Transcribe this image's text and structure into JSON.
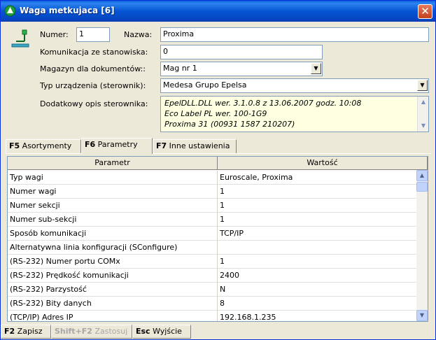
{
  "window": {
    "title": "Waga metkujaca [6]",
    "close_glyph": "✕"
  },
  "form": {
    "numer_label": "Numer:",
    "numer_value": "1",
    "nazwa_label": "Nazwa:",
    "nazwa_value": "Proxima",
    "komunikacja_label": "Komunikacja ze stanowiska:",
    "komunikacja_value": "0",
    "magazyn_label": "Magazyn dla dokumentów::",
    "magazyn_value": "Mag nr 1",
    "typ_label": "Typ urządzenia (sterownik):",
    "typ_value": "Medesa Grupo Epelsa",
    "opis_label": "Dodatkowy opis sterownika:",
    "opis_lines": [
      "EpelDLL.DLL wer. 3.1.0.8 z 13.06.2007 godz. 10:08",
      "Eco Label PL wer. 100-1G9",
      "Proxima 31 (00931 1587 210207)"
    ]
  },
  "tabs": [
    {
      "key": "F5",
      "label": "Asortymenty"
    },
    {
      "key": "F6",
      "label": "Parametry"
    },
    {
      "key": "F7",
      "label": "Inne ustawienia"
    }
  ],
  "grid": {
    "col_parametr": "Parametr",
    "col_wartosc": "Wartość",
    "rows": [
      {
        "param": "Typ wagi",
        "value": "Euroscale, Proxima"
      },
      {
        "param": "Numer wagi",
        "value": "1"
      },
      {
        "param": "Numer sekcji",
        "value": "1"
      },
      {
        "param": "Numer sub-sekcji",
        "value": "1"
      },
      {
        "param": "Sposób komunikacji",
        "value": "TCP/IP"
      },
      {
        "param": "Alternatywna linia konfiguracji (SConfigure)",
        "value": ""
      },
      {
        "param": "(RS-232) Numer portu COMx",
        "value": "1"
      },
      {
        "param": "(RS-232) Prędkość komunikacji",
        "value": "2400"
      },
      {
        "param": "(RS-232) Parzystość",
        "value": "N"
      },
      {
        "param": "(RS-232) Bity danych",
        "value": "8"
      },
      {
        "param": "(TCP/IP) Adres IP",
        "value": "192.168.1.235"
      }
    ]
  },
  "statusbar": [
    {
      "key": "F2",
      "label": "Zapisz",
      "disabled": false
    },
    {
      "key": "Shift+F2",
      "label": "Zastosuj",
      "disabled": true
    },
    {
      "key": "Esc",
      "label": "Wyjście",
      "disabled": false
    }
  ],
  "colors": {
    "titlebar": "#0655d4",
    "memo_bg": "#ffffe1",
    "dialog_bg": "#ece9d8"
  }
}
